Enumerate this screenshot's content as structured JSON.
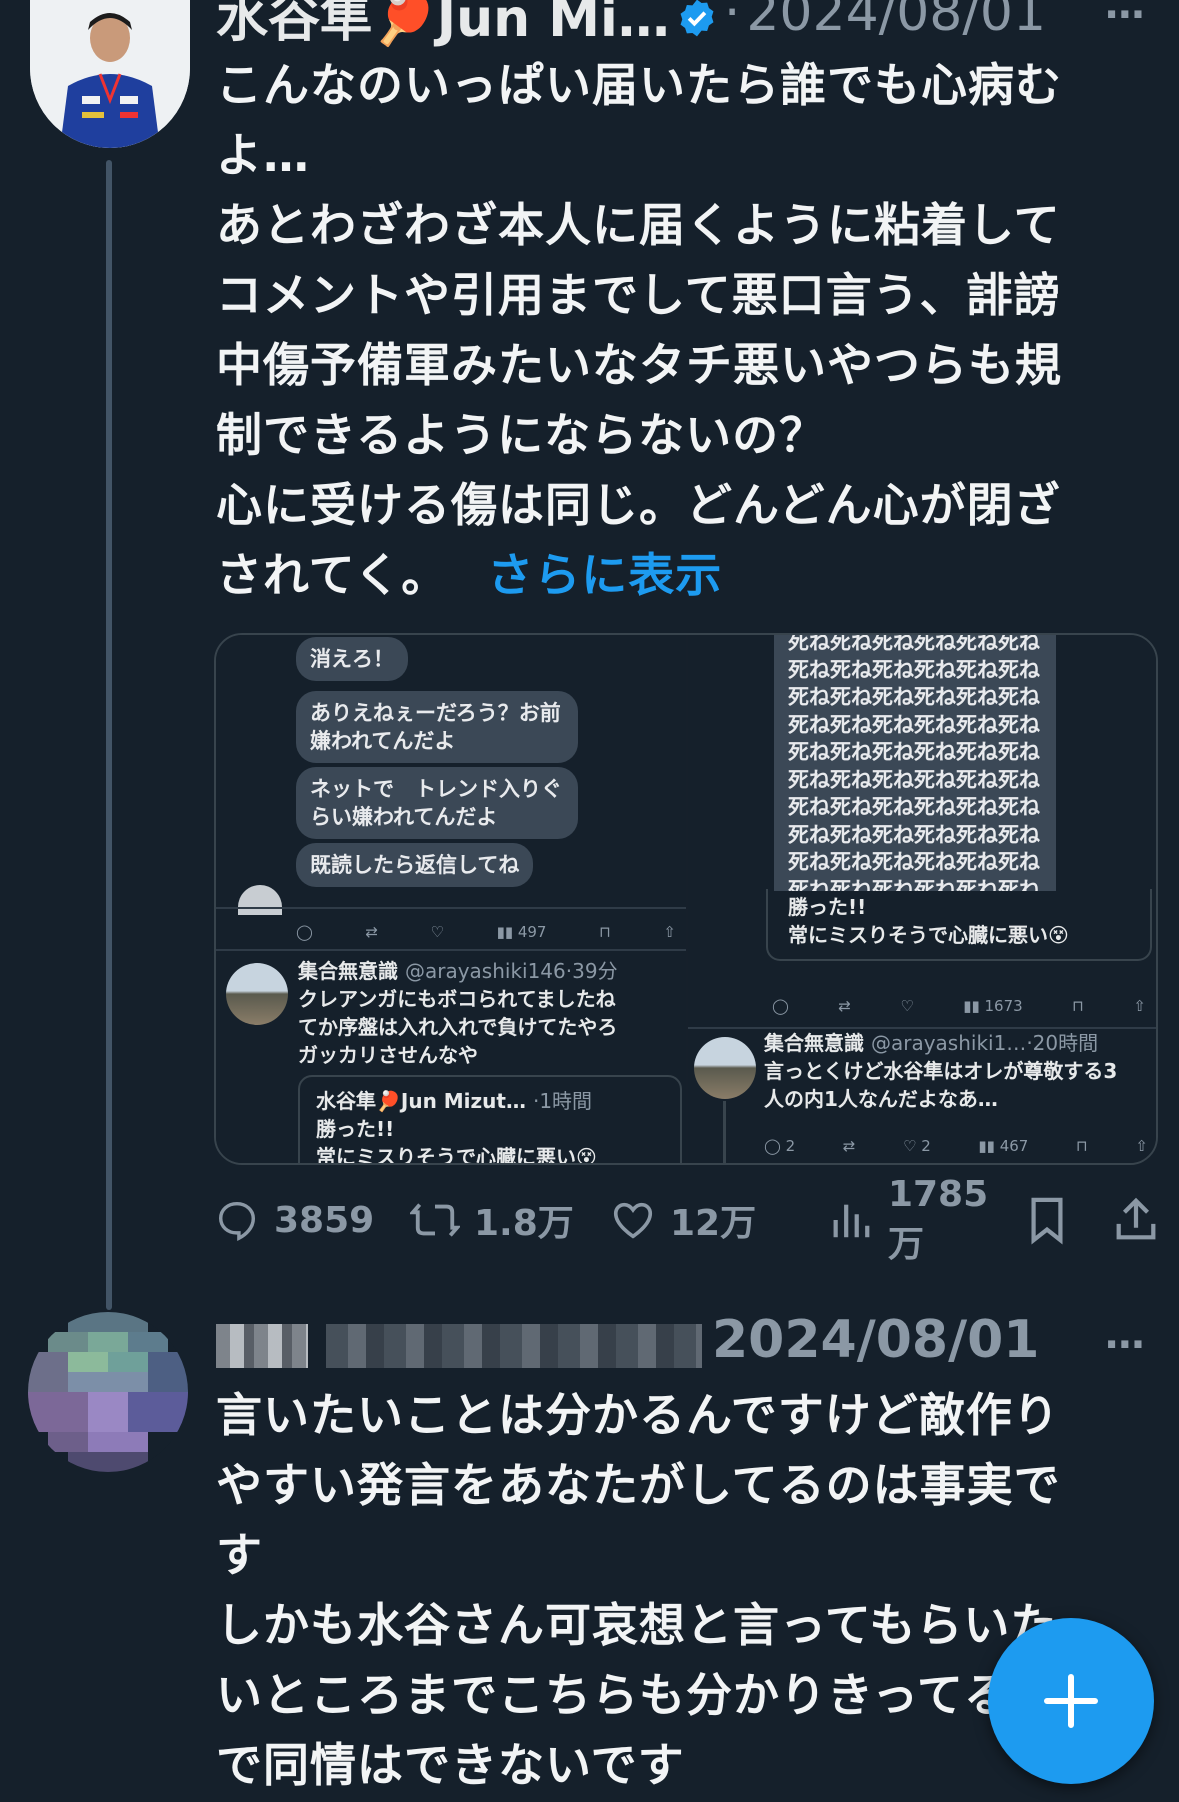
{
  "tweet1": {
    "display_name": "水谷隼🏓Jun Mi…",
    "timestamp": "2024/08/01",
    "separator": "·",
    "more_label": "···",
    "lines": [
      "こんなのいっぱい届いたら誰でも心病む",
      "よ…",
      "あとわざわざ本人に届くように粘着して",
      "コメントや引用までして悪口言う、誹謗",
      "中傷予備軍みたいなタチ悪いやつらも規",
      "制できるようにならないの？",
      "心に受ける傷は同じ。どんどん心が閉ざ"
    ],
    "last_line": "されてく。",
    "show_more": "さらに表示",
    "actions": {
      "replies": "3859",
      "retweets": "1.8万",
      "likes": "12万",
      "views": "1785万"
    }
  },
  "media": {
    "left_bubbles": [
      "消えろ！",
      "ありえねぇーだろう？お前\n嫌われてんだよ",
      "ネットで　トレンド入りぐ\nらい嫌われてんだよ",
      "既読したら返信してね"
    ],
    "left_views": "497",
    "left_quote": {
      "name": "集合無意識",
      "handle": "@arayashiki146",
      "time": "39分",
      "text": [
        "クレアンガにもボコられてましたね",
        "てか序盤は入れ入れで負けてたやろ",
        "ガッカリさせんなや"
      ],
      "quoted_name": "水谷隼🏓Jun Mizut…",
      "quoted_time": "1時間",
      "quoted_text": [
        "勝った!!",
        "常にミスりそうで心臓に悪い😵"
      ]
    },
    "right_spam_row": "死ね死ね死ね死ね死ね死ね",
    "right_quote_text": [
      "勝った!!",
      "常にミスりそうで心臓に悪い😵"
    ],
    "right_views": "1673",
    "right_reply": {
      "name": "集合無意識",
      "handle": "@arayashiki1…",
      "time": "20時間",
      "text": [
        "言っとくけど水谷隼はオレが尊敬する3",
        "人の内1人なんだよなあ…"
      ],
      "replies": "2",
      "likes": "2",
      "views": "467"
    }
  },
  "tweet2": {
    "timestamp": "2024/08/01",
    "more_label": "···",
    "lines": [
      "言いたいことは分かるんですけど敵作り",
      "やすい発言をあなたがしてるのは事実で",
      "す",
      "しかも水谷さん可哀想と言ってもらいた",
      "いところまでこちらも分かりきってるの",
      "で同情はできないです"
    ]
  },
  "colors": {
    "background": "#15202b",
    "accent": "#1d9bf0",
    "muted": "#8b98a5",
    "text": "#e7e9ea"
  },
  "fab": {
    "icon": "plus-icon"
  }
}
